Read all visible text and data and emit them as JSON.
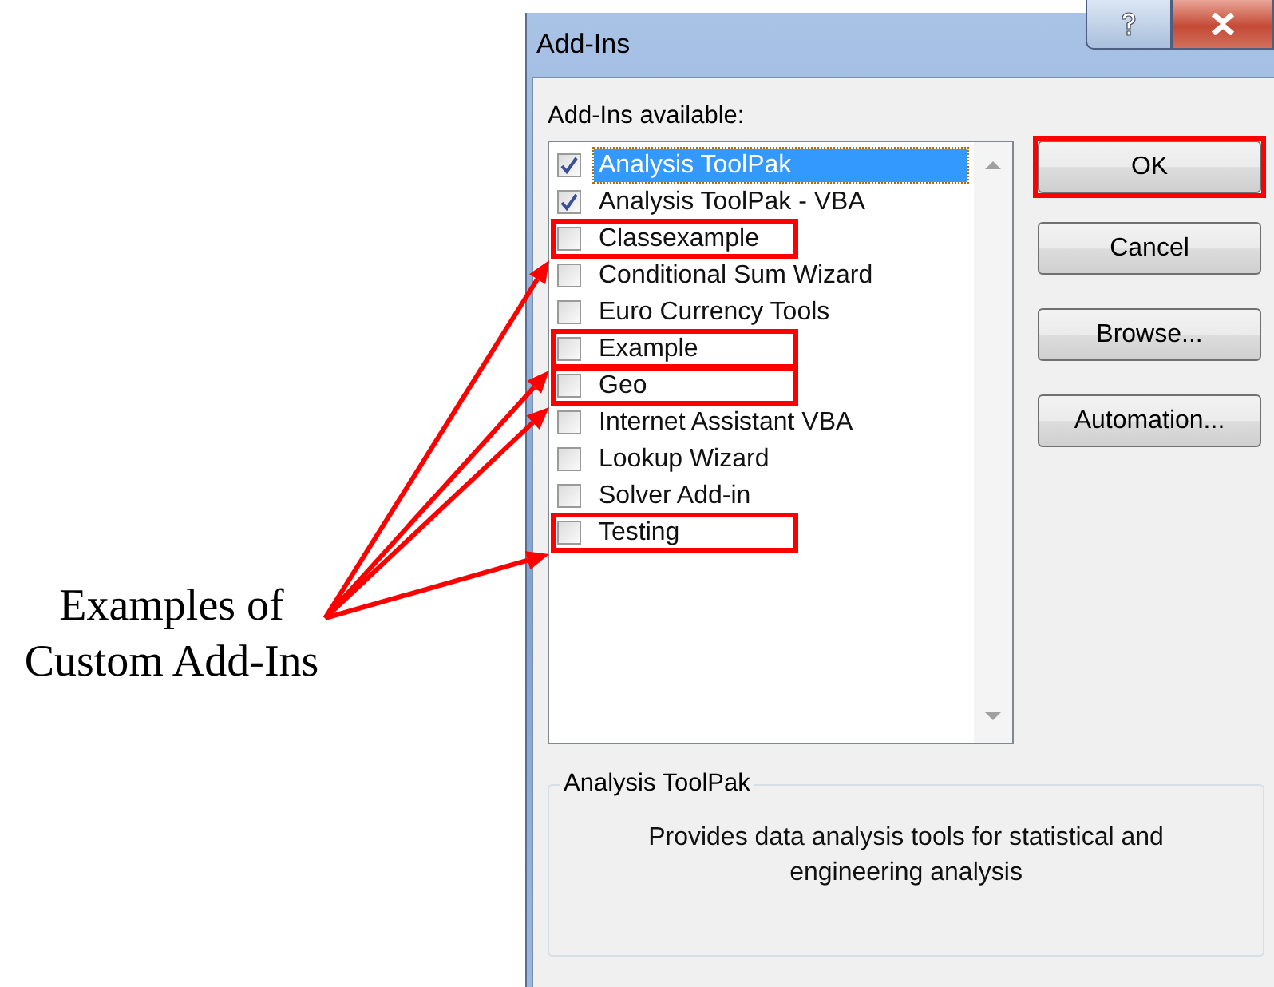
{
  "annotation": {
    "text": "Examples of\nCustom Add-Ins"
  },
  "window": {
    "title": "Add-Ins"
  },
  "list": {
    "label": "Add-Ins available:",
    "items": [
      {
        "label": "Analysis ToolPak",
        "checked": true,
        "selected": true,
        "highlighted": false
      },
      {
        "label": "Analysis ToolPak - VBA",
        "checked": true,
        "selected": false,
        "highlighted": false
      },
      {
        "label": "Classexample",
        "checked": false,
        "selected": false,
        "highlighted": true
      },
      {
        "label": "Conditional Sum Wizard",
        "checked": false,
        "selected": false,
        "highlighted": false
      },
      {
        "label": "Euro Currency Tools",
        "checked": false,
        "selected": false,
        "highlighted": false
      },
      {
        "label": "Example",
        "checked": false,
        "selected": false,
        "highlighted": true
      },
      {
        "label": "Geo",
        "checked": false,
        "selected": false,
        "highlighted": true
      },
      {
        "label": "Internet Assistant VBA",
        "checked": false,
        "selected": false,
        "highlighted": false
      },
      {
        "label": "Lookup Wizard",
        "checked": false,
        "selected": false,
        "highlighted": false
      },
      {
        "label": "Solver Add-in",
        "checked": false,
        "selected": false,
        "highlighted": false
      },
      {
        "label": "Testing",
        "checked": false,
        "selected": false,
        "highlighted": true
      }
    ]
  },
  "buttons": [
    {
      "label": "OK",
      "highlighted": true
    },
    {
      "label": "Cancel",
      "highlighted": false
    },
    {
      "label": "Browse...",
      "highlighted": false
    },
    {
      "label": "Automation...",
      "highlighted": false
    }
  ],
  "details": {
    "title": "Analysis ToolPak",
    "description": "Provides data analysis tools for statistical and engineering analysis"
  }
}
